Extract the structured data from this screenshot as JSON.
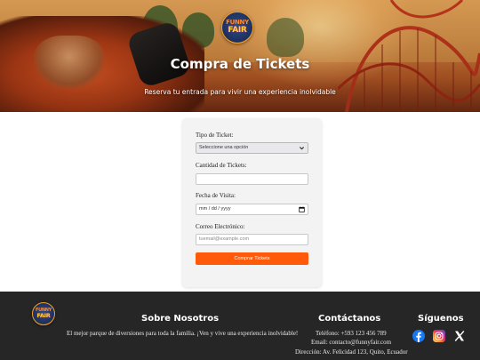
{
  "hero": {
    "logo": {
      "line1": "FUNNY",
      "line2": "FAIR"
    },
    "title": "Compra de Tickets",
    "subtitle": "Reserva tu entrada para vivir una experiencia inolvidable"
  },
  "form": {
    "ticket_type": {
      "label": "Tipo de Ticket:",
      "selected": "Seleccione una opción"
    },
    "quantity": {
      "label": "Cantidad de Tickets:",
      "value": ""
    },
    "visit_date": {
      "label": "Fecha de Visita:",
      "placeholder": "mm / dd / yyyy"
    },
    "email": {
      "label": "Correo Electrónico:",
      "placeholder": "tuemail@example.com"
    },
    "submit_label": "Comprar Tickets",
    "accent_color": "#ff5a0a"
  },
  "footer": {
    "logo": {
      "line1": "FUNNY",
      "line2": "FAIR"
    },
    "about": {
      "heading": "Sobre Nosotros",
      "text": "El mejor parque de diversiones para toda la familia. ¡Ven y vive una experiencia inolvidable!"
    },
    "contact": {
      "heading": "Contáctanos",
      "phone": "Teléfono: +593 123 456 789",
      "email": "Email: contacto@funnyfair.com",
      "address": "Dirección: Av. Felicidad 123, Quito, Ecuador"
    },
    "social": {
      "heading": "Síguenos",
      "icons": [
        "facebook-icon",
        "instagram-icon",
        "x-icon"
      ]
    }
  }
}
